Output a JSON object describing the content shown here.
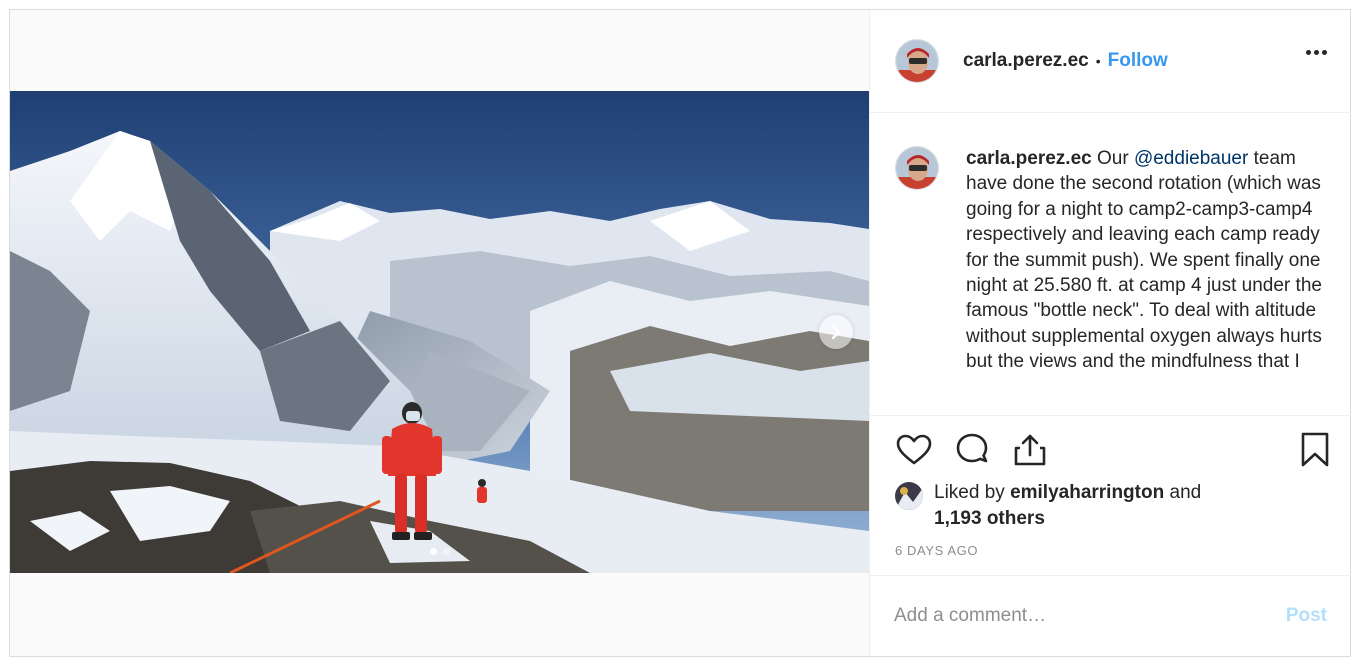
{
  "post": {
    "username": "carla.perez.ec",
    "separator": "•",
    "follow_label": "Follow",
    "more_icon": "more-horizontal-icon"
  },
  "caption": {
    "username": "carla.perez.ec",
    "before_mention": "Our",
    "mention": "@eddiebauer",
    "body": "team have done the second rotation (which was going for a night to camp2-camp3-camp4 respectively and leaving each camp ready for the summit push). We spent finally one night at 25.580 ft. at camp 4 just under the famous \"bottle neck\". To deal with altitude without supplemental oxygen always hurts but the views and the mindfulness that I"
  },
  "carousel": {
    "slide_count": 2,
    "active_slide": 1
  },
  "actions": {
    "like_icon": "heart-icon",
    "comment_icon": "comment-icon",
    "share_icon": "share-icon",
    "save_icon": "bookmark-icon"
  },
  "likes": {
    "prefix": "Liked by",
    "user": "emilyaharrington",
    "conjunction": "and",
    "others": "1,193 others"
  },
  "timestamp": "6 DAYS AGO",
  "comment": {
    "placeholder": "Add a comment…",
    "post_label": "Post"
  },
  "colors": {
    "accent": "#3897f0",
    "mention": "#003569",
    "post_disabled": "#b2dffc",
    "meta": "#8e8e8e"
  }
}
